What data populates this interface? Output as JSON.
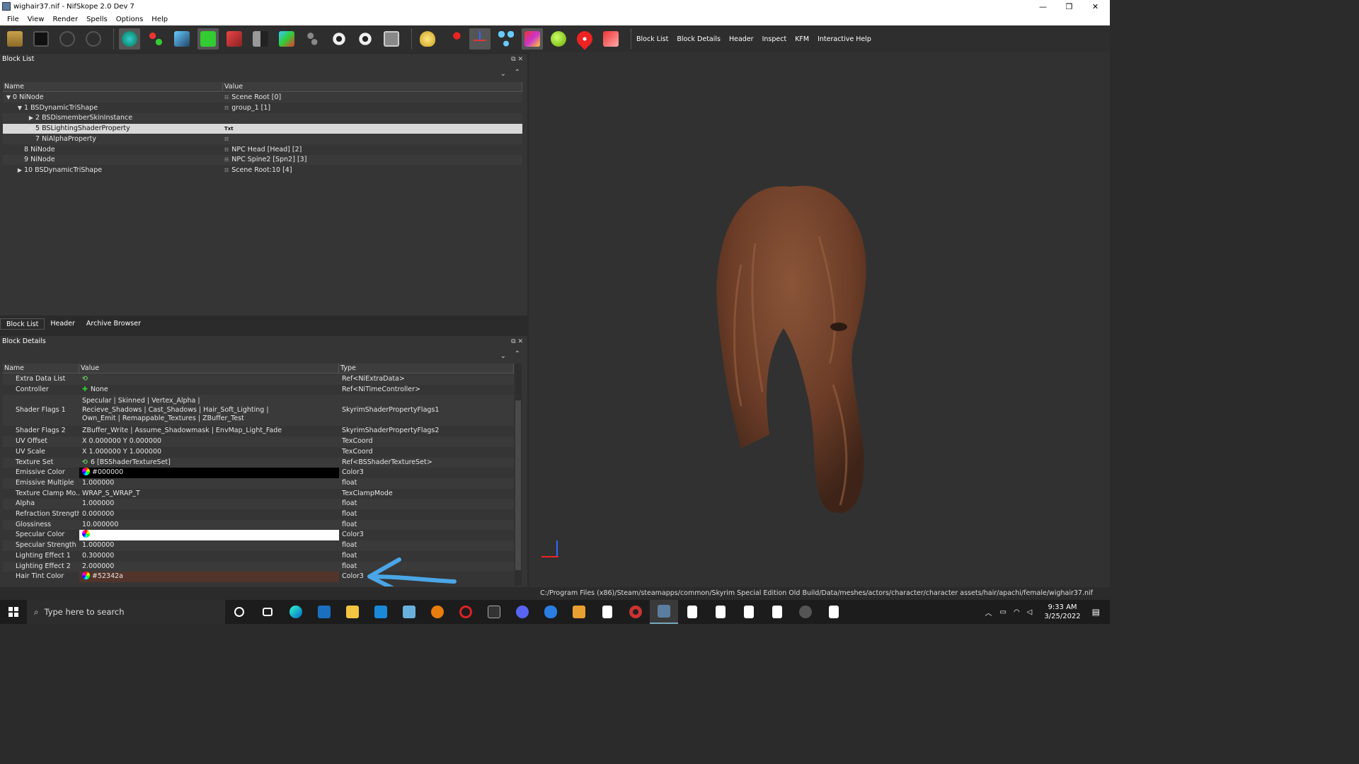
{
  "window": {
    "title": "wighair37.nif - NifSkope 2.0 Dev 7",
    "minimize": "—",
    "maximize": "❐",
    "close": "✕"
  },
  "menu": [
    "File",
    "View",
    "Render",
    "Spells",
    "Options",
    "Help"
  ],
  "toolbar": {
    "links": [
      "Block List",
      "Block Details",
      "Header",
      "Inspect",
      "KFM",
      "Interactive Help"
    ]
  },
  "blocklist": {
    "title": "Block List",
    "columns": [
      "Name",
      "Value"
    ],
    "rows": [
      {
        "name": "0 NiNode",
        "value": "Scene Root [0]",
        "indent": 0,
        "expander": "▼",
        "icon": "txt"
      },
      {
        "name": "1 BSDynamicTriShape",
        "value": "group_1 [1]",
        "indent": 1,
        "expander": "▼",
        "icon": "txt"
      },
      {
        "name": "2 BSDismemberSkinInstance",
        "value": "",
        "indent": 2,
        "expander": "▶",
        "icon": ""
      },
      {
        "name": "5 BSLightingShaderProperty",
        "value": "Txt",
        "indent": 2,
        "expander": "▶",
        "icon": "",
        "selected": true
      },
      {
        "name": "7 NiAlphaProperty",
        "value": "",
        "indent": 2,
        "expander": "",
        "icon": "txt"
      },
      {
        "name": "8 NiNode",
        "value": "NPC Head [Head] [2]",
        "indent": 1,
        "expander": "",
        "icon": "txt"
      },
      {
        "name": "9 NiNode",
        "value": "NPC Spine2 [Spn2] [3]",
        "indent": 1,
        "expander": "",
        "icon": "txt"
      },
      {
        "name": "10 BSDynamicTriShape",
        "value": "Scene Root:10 [4]",
        "indent": 1,
        "expander": "▶",
        "icon": "txt"
      }
    ],
    "tabs": [
      "Block List",
      "Header",
      "Archive Browser"
    ]
  },
  "details": {
    "title": "Block Details",
    "columns": [
      "Name",
      "Value",
      "Type"
    ],
    "rows": [
      {
        "name": "Extra Data List",
        "value": "",
        "type": "Ref<NiExtraData>",
        "icon": "link-icon"
      },
      {
        "name": "Controller",
        "value": "None",
        "type": "Ref<NiTimeController>",
        "icon": "plus-icon"
      },
      {
        "name": "Shader Flags 1",
        "value": "Specular | Skinned | Vertex_Alpha |\nRecieve_Shadows | Cast_Shadows | Hair_Soft_Lighting |\nOwn_Emit | Remappable_Textures | ZBuffer_Test",
        "type": "SkyrimShaderPropertyFlags1",
        "tall": true
      },
      {
        "name": "Shader Flags 2",
        "value": "ZBuffer_Write | Assume_Shadowmask | EnvMap_Light_Fade",
        "type": "SkyrimShaderPropertyFlags2"
      },
      {
        "name": "UV Offset",
        "value": "X 0.000000 Y 0.000000",
        "type": "TexCoord"
      },
      {
        "name": "UV Scale",
        "value": "X 1.000000 Y 1.000000",
        "type": "TexCoord"
      },
      {
        "name": "Texture Set",
        "value": "6 [BSShaderTextureSet]",
        "type": "Ref<BSShaderTextureSet>",
        "icon": "link-icon"
      },
      {
        "name": "Emissive Color",
        "value": "#000000",
        "type": "Color3",
        "swatch": "#000000"
      },
      {
        "name": "Emissive Multiple",
        "value": "1.000000",
        "type": "float"
      },
      {
        "name": "Texture Clamp Mo...",
        "value": "WRAP_S_WRAP_T",
        "type": "TexClampMode"
      },
      {
        "name": "Alpha",
        "value": "1.000000",
        "type": "float"
      },
      {
        "name": "Refraction Strength",
        "value": "0.000000",
        "type": "float"
      },
      {
        "name": "Glossiness",
        "value": "10.000000",
        "type": "float"
      },
      {
        "name": "Specular Color",
        "value": "",
        "type": "Color3",
        "swatch": "#ffffff"
      },
      {
        "name": "Specular Strength",
        "value": "1.000000",
        "type": "float"
      },
      {
        "name": "Lighting Effect 1",
        "value": "0.300000",
        "type": "float"
      },
      {
        "name": "Lighting Effect 2",
        "value": "2.000000",
        "type": "float"
      },
      {
        "name": "Hair Tint Color",
        "value": "#52342a",
        "type": "Color3",
        "swatch": "#52342a"
      }
    ]
  },
  "statusbar": {
    "path": "C:/Program Files (x86)/Steam/steamapps/common/Skyrim Special Edition Old Build/Data/meshes/actors/character/character assets/hair/apachi/female/wighair37.nif"
  },
  "taskbar": {
    "search_placeholder": "Type here to search",
    "time": "9:33 AM",
    "date": "3/25/2022"
  },
  "colors": {
    "hair_tint": "#52342a",
    "annotation_arrow": "#4aa6e6"
  }
}
